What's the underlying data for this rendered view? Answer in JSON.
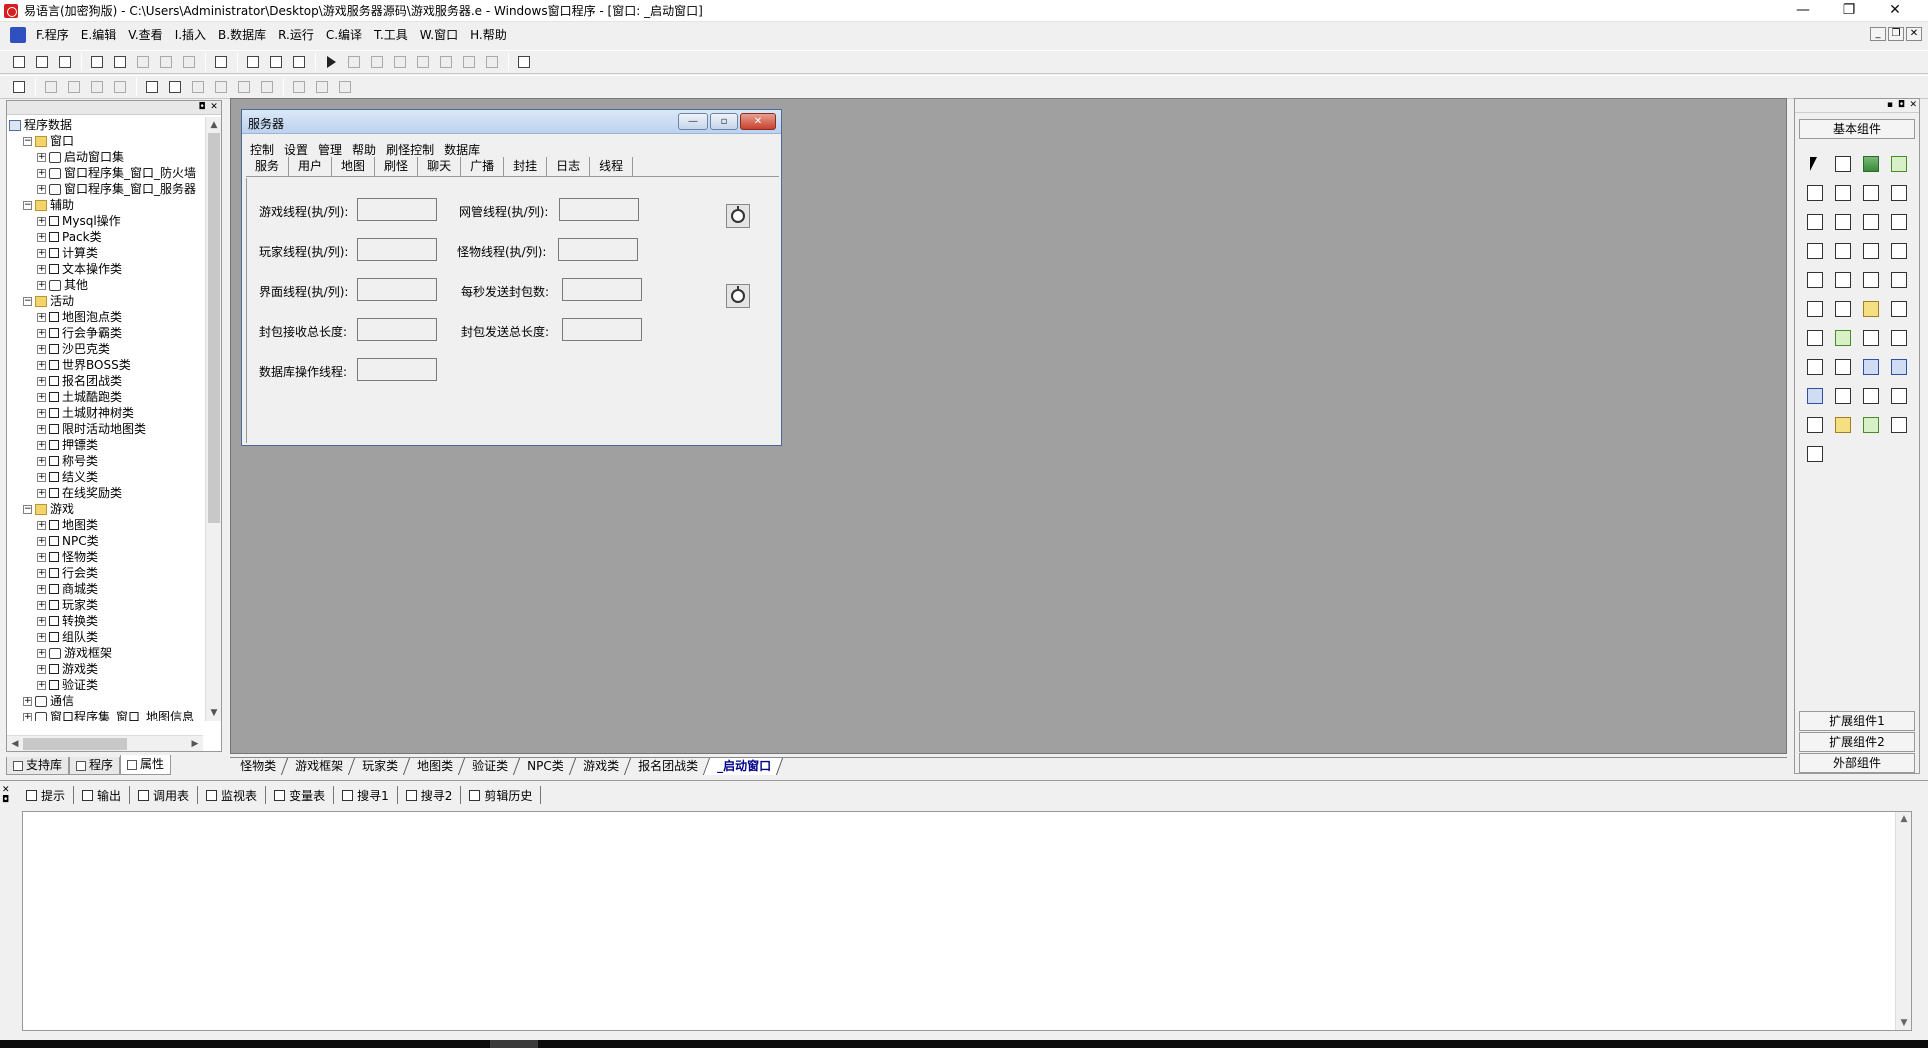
{
  "window": {
    "title": "易语言(加密狗版) - C:\\Users\\Administrator\\Desktop\\游戏服务器源码\\游戏服务器.e - Windows窗口程序 - [窗口: _启动窗口]",
    "minimize": "—",
    "maximize": "❐",
    "close": "✕"
  },
  "menu": {
    "items": [
      "F.程序",
      "E.编辑",
      "V.查看",
      "I.插入",
      "B.数据库",
      "R.运行",
      "C.编译",
      "T.工具",
      "W.窗口",
      "H.帮助"
    ]
  },
  "tree": {
    "nodes": [
      {
        "label": "程序数据",
        "level": 0,
        "expander": "",
        "icon": "root"
      },
      {
        "label": "窗口",
        "level": 1,
        "expander": "−",
        "icon": "folder"
      },
      {
        "label": "启动窗口集",
        "level": 2,
        "expander": "+",
        "icon": "module"
      },
      {
        "label": "窗口程序集_窗口_防火墙",
        "level": 2,
        "expander": "+",
        "icon": "module"
      },
      {
        "label": "窗口程序集_窗口_服务器",
        "level": 2,
        "expander": "+",
        "icon": "module"
      },
      {
        "label": "辅助",
        "level": 1,
        "expander": "−",
        "icon": "folder"
      },
      {
        "label": "Mysql操作",
        "level": 2,
        "expander": "+",
        "icon": "cls"
      },
      {
        "label": "Pack类",
        "level": 2,
        "expander": "+",
        "icon": "cls"
      },
      {
        "label": "计算类",
        "level": 2,
        "expander": "+",
        "icon": "cls"
      },
      {
        "label": "文本操作类",
        "level": 2,
        "expander": "+",
        "icon": "cls"
      },
      {
        "label": "其他",
        "level": 2,
        "expander": "+",
        "icon": "module"
      },
      {
        "label": "活动",
        "level": 1,
        "expander": "−",
        "icon": "folder"
      },
      {
        "label": "地图泡点类",
        "level": 2,
        "expander": "+",
        "icon": "cls"
      },
      {
        "label": "行会争霸类",
        "level": 2,
        "expander": "+",
        "icon": "cls"
      },
      {
        "label": "沙巴克类",
        "level": 2,
        "expander": "+",
        "icon": "cls"
      },
      {
        "label": "世界BOSS类",
        "level": 2,
        "expander": "+",
        "icon": "cls"
      },
      {
        "label": "报名团战类",
        "level": 2,
        "expander": "+",
        "icon": "cls"
      },
      {
        "label": "土城酷跑类",
        "level": 2,
        "expander": "+",
        "icon": "cls"
      },
      {
        "label": "土城财神树类",
        "level": 2,
        "expander": "+",
        "icon": "cls"
      },
      {
        "label": "限时活动地图类",
        "level": 2,
        "expander": "+",
        "icon": "cls"
      },
      {
        "label": "押镖类",
        "level": 2,
        "expander": "+",
        "icon": "cls"
      },
      {
        "label": "称号类",
        "level": 2,
        "expander": "+",
        "icon": "cls"
      },
      {
        "label": "结义类",
        "level": 2,
        "expander": "+",
        "icon": "cls"
      },
      {
        "label": "在线奖励类",
        "level": 2,
        "expander": "+",
        "icon": "cls"
      },
      {
        "label": "游戏",
        "level": 1,
        "expander": "−",
        "icon": "folder"
      },
      {
        "label": "地图类",
        "level": 2,
        "expander": "+",
        "icon": "cls"
      },
      {
        "label": "NPC类",
        "level": 2,
        "expander": "+",
        "icon": "cls"
      },
      {
        "label": "怪物类",
        "level": 2,
        "expander": "+",
        "icon": "cls"
      },
      {
        "label": "行会类",
        "level": 2,
        "expander": "+",
        "icon": "cls"
      },
      {
        "label": "商城类",
        "level": 2,
        "expander": "+",
        "icon": "cls"
      },
      {
        "label": "玩家类",
        "level": 2,
        "expander": "+",
        "icon": "cls"
      },
      {
        "label": "转换类",
        "level": 2,
        "expander": "+",
        "icon": "cls"
      },
      {
        "label": "组队类",
        "level": 2,
        "expander": "+",
        "icon": "cls"
      },
      {
        "label": "游戏框架",
        "level": 2,
        "expander": "+",
        "icon": "module"
      },
      {
        "label": "游戏类",
        "level": 2,
        "expander": "+",
        "icon": "cls"
      },
      {
        "label": "验证类",
        "level": 2,
        "expander": "+",
        "icon": "cls"
      },
      {
        "label": "通信",
        "level": 1,
        "expander": "+",
        "icon": "module"
      },
      {
        "label": "窗口程序集_窗口_地图信息",
        "level": 1,
        "expander": "+",
        "icon": "module"
      }
    ]
  },
  "left_tabs": [
    "支持库",
    "程序",
    "属性"
  ],
  "designer": {
    "window_title": "服务器",
    "menu": [
      "控制",
      "设置",
      "管理",
      "帮助",
      "刷怪控制",
      "数据库"
    ],
    "tabs": [
      "服务",
      "用户",
      "地图",
      "刷怪",
      "聊天",
      "广播",
      "封挂",
      "日志",
      "线程"
    ],
    "active_tab": "线程",
    "fields": {
      "game_threads": "游戏线程(执/列):",
      "net_threads": "网管线程(执/列):",
      "player_threads": "玩家线程(执/列):",
      "monster_threads": "怪物线程(执/列):",
      "ui_threads": "界面线程(执/列):",
      "packets_per_sec": "每秒发送封包数:",
      "recv_total": "封包接收总长度:",
      "send_total": "封包发送总长度:",
      "db_threads": "数据库操作线程:"
    }
  },
  "right_panel": {
    "basic": "基本组件",
    "ext1": "扩展组件1",
    "ext2": "扩展组件2",
    "external": "外部组件"
  },
  "doc_tabs": [
    "怪物类",
    "游戏框架",
    "玩家类",
    "地图类",
    "验证类",
    "NPC类",
    "游戏类",
    "报名团战类",
    "_启动窗口"
  ],
  "active_doc_tab": "_启动窗口",
  "output_tabs": [
    "提示",
    "输出",
    "调用表",
    "监视表",
    "变量表",
    "搜寻1",
    "搜寻2",
    "剪辑历史"
  ]
}
